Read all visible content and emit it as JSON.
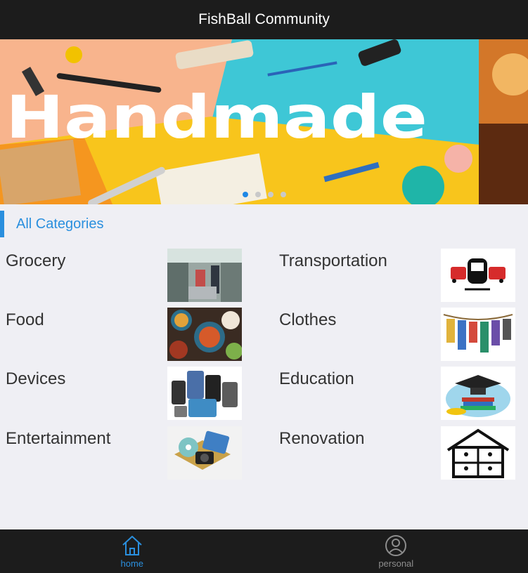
{
  "header": {
    "title": "FishBall Community"
  },
  "banner": {
    "text": "Handmade",
    "slide_count": 4,
    "active_slide": 0
  },
  "section": {
    "title": "All Categories"
  },
  "categories": [
    {
      "label": "Grocery",
      "icon": "grocery-image"
    },
    {
      "label": "Transportation",
      "icon": "transportation-image"
    },
    {
      "label": "Food",
      "icon": "food-image"
    },
    {
      "label": "Clothes",
      "icon": "clothes-image"
    },
    {
      "label": "Devices",
      "icon": "devices-image"
    },
    {
      "label": "Education",
      "icon": "education-image"
    },
    {
      "label": "Entertainment",
      "icon": "entertainment-image"
    },
    {
      "label": "Renovation",
      "icon": "renovation-image"
    }
  ],
  "tabbar": {
    "home_label": "home",
    "personal_label": "personal",
    "active_tab": "home"
  },
  "colors": {
    "accent": "#2a8fde",
    "bar": "#1c1c1c",
    "background": "#efeff4"
  }
}
